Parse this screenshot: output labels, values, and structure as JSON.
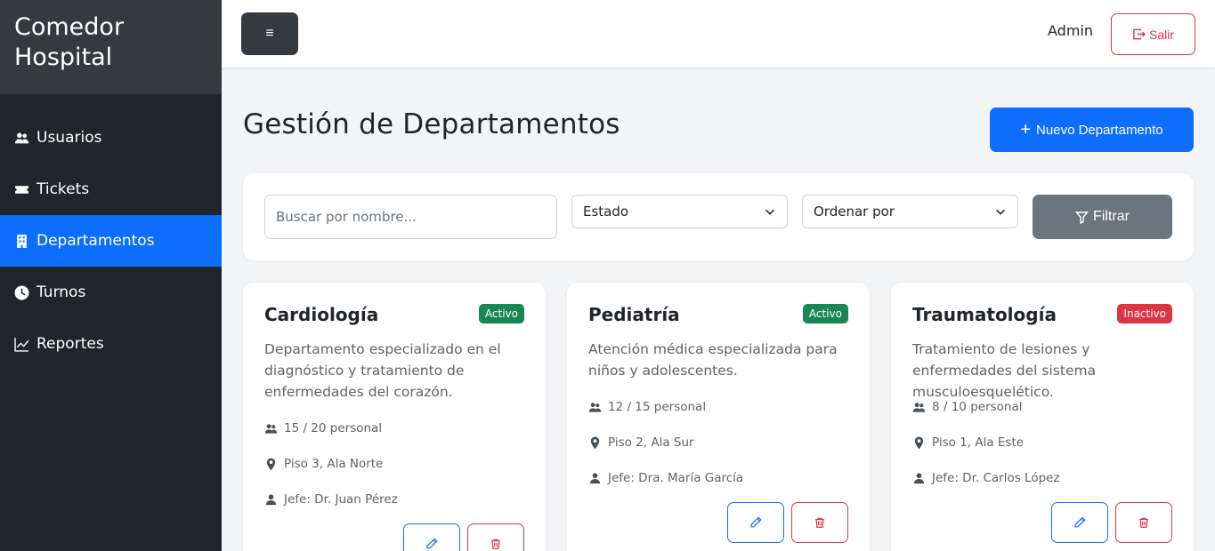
{
  "brand": {
    "line1": "Comedor",
    "line2": "Hospital"
  },
  "sidebar": {
    "items": [
      {
        "label": "Usuarios",
        "icon": "users-icon"
      },
      {
        "label": "Tickets",
        "icon": "ticket-icon"
      },
      {
        "label": "Departamentos",
        "icon": "building-icon",
        "active": true
      },
      {
        "label": "Turnos",
        "icon": "clock-icon"
      },
      {
        "label": "Reportes",
        "icon": "chart-line-icon"
      }
    ]
  },
  "topbar": {
    "menu_label": "≡",
    "user": "Admin",
    "logout_label": "Salir"
  },
  "main": {
    "title": "Gestión de Departamentos",
    "new_button": "Nuevo Departamento",
    "filters": {
      "search_placeholder": "Buscar por nombre...",
      "estado": "Estado",
      "ordenar": "Ordenar por",
      "filter_button": "Filtrar"
    },
    "departments": [
      {
        "name": "Cardiología",
        "status": "Activo",
        "description": "Departamento especializado en el diagnóstico y tratamiento de enfermedades del corazón.",
        "staff": "15 / 20 personal",
        "location": "Piso 3, Ala Norte",
        "head": "Jefe: Dr. Juan Pérez"
      },
      {
        "name": "Pediatría",
        "status": "Activo",
        "description": "Atención médica especializada para niños y adolescentes.",
        "staff": "12 / 15 personal",
        "location": "Piso 2, Ala Sur",
        "head": "Jefe: Dra. María García"
      },
      {
        "name": "Traumatología",
        "status": "Inactivo",
        "description": "Tratamiento de lesiones y enfermedades del sistema musculoesquelético.",
        "staff": "8 / 10 personal",
        "location": "Piso 1, Ala Este",
        "head": "Jefe: Dr. Carlos López"
      }
    ]
  },
  "colors": {
    "primary": "#0d6efd",
    "sidebar": "#212529",
    "success": "#198754",
    "danger": "#dc3545",
    "secondary": "#6c757d"
  }
}
